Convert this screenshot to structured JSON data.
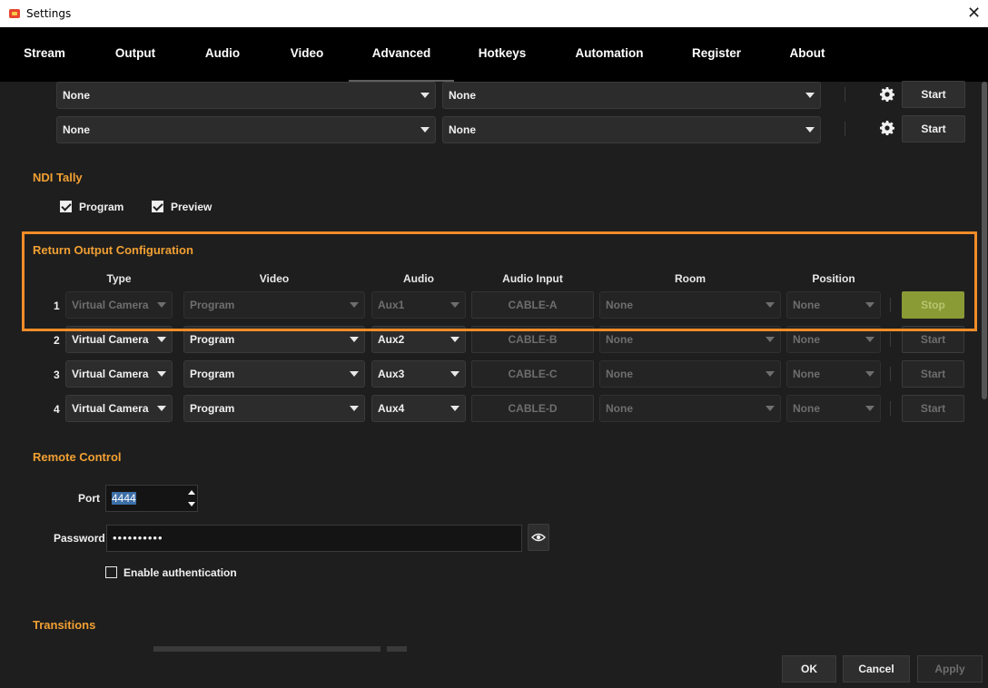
{
  "window": {
    "title": "Settings"
  },
  "tabs": [
    "Stream",
    "Output",
    "Audio",
    "Video",
    "Advanced",
    "Hotkeys",
    "Automation",
    "Register",
    "About"
  ],
  "top_rows": [
    {
      "left": "None",
      "right": "None",
      "button": "Start"
    },
    {
      "left": "None",
      "right": "None",
      "button": "Start"
    }
  ],
  "ndi_tally": {
    "title": "NDI Tally",
    "program_label": "Program",
    "preview_label": "Preview"
  },
  "return_output": {
    "title": "Return Output Configuration",
    "columns": {
      "type": "Type",
      "video": "Video",
      "audio": "Audio",
      "audio_input": "Audio Input",
      "room": "Room",
      "position": "Position"
    },
    "rows": [
      {
        "num": "1",
        "type": "Virtual Camera",
        "video": "Program",
        "audio": "Aux1",
        "input": "CABLE-A",
        "room": "None",
        "position": "None",
        "button": "Stop"
      },
      {
        "num": "2",
        "type": "Virtual Camera",
        "video": "Program",
        "audio": "Aux2",
        "input": "CABLE-B",
        "room": "None",
        "position": "None",
        "button": "Start"
      },
      {
        "num": "3",
        "type": "Virtual Camera",
        "video": "Program",
        "audio": "Aux3",
        "input": "CABLE-C",
        "room": "None",
        "position": "None",
        "button": "Start"
      },
      {
        "num": "4",
        "type": "Virtual Camera",
        "video": "Program",
        "audio": "Aux4",
        "input": "CABLE-D",
        "room": "None",
        "position": "None",
        "button": "Start"
      }
    ]
  },
  "remote_control": {
    "title": "Remote Control",
    "port_label": "Port",
    "port_value": "4444",
    "password_label": "Password",
    "password_value": "••••••••••",
    "auth_label": "Enable authentication"
  },
  "transitions": {
    "title": "Transitions"
  },
  "footer": {
    "ok": "OK",
    "cancel": "Cancel",
    "apply": "Apply"
  },
  "colors": {
    "accent": "#f2a033",
    "highlight": "#f28c28",
    "stop": "#8a9b36"
  }
}
